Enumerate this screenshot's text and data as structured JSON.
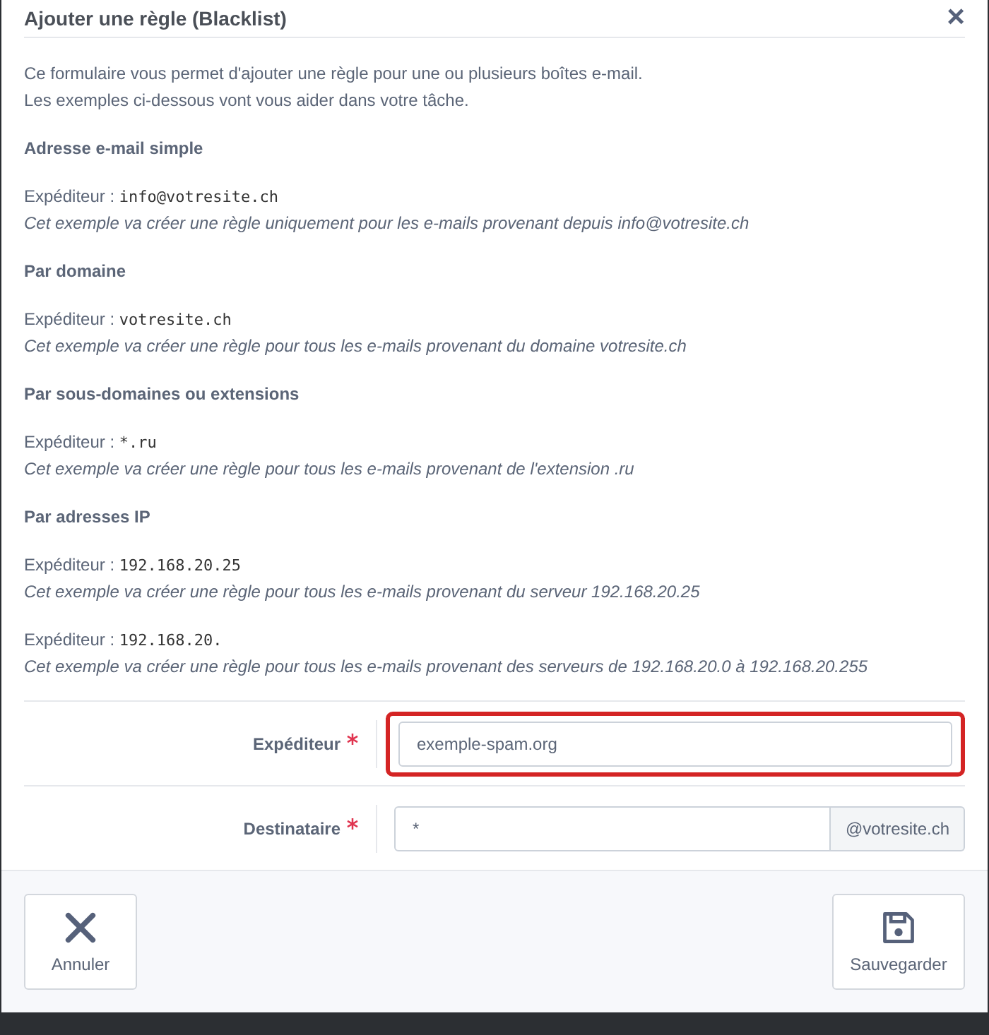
{
  "dialog": {
    "title": "Ajouter une règle (Blacklist)",
    "close": "×"
  },
  "intro": [
    "Ce formulaire vous permet d'ajouter une règle pour une ou plusieurs boîtes e-mail.",
    "Les exemples ci-dessous vont vous aider dans votre tâche."
  ],
  "sections": [
    {
      "heading": "Adresse e-mail simple",
      "examples": [
        {
          "label": "Expéditeur :",
          "code": "info@votresite.ch",
          "description": "Cet exemple va créer une règle uniquement pour les e-mails provenant depuis info@votresite.ch"
        }
      ]
    },
    {
      "heading": "Par domaine",
      "examples": [
        {
          "label": "Expéditeur :",
          "code": "votresite.ch",
          "description": "Cet exemple va créer une règle pour tous les e-mails provenant du domaine votresite.ch"
        }
      ]
    },
    {
      "heading": "Par sous-domaines ou extensions",
      "examples": [
        {
          "label": "Expéditeur :",
          "code": "*.ru",
          "description": "Cet exemple va créer une règle pour tous les e-mails provenant de l'extension .ru"
        }
      ]
    },
    {
      "heading": "Par adresses IP",
      "examples": [
        {
          "label": "Expéditeur :",
          "code": "192.168.20.25",
          "description": "Cet exemple va créer une règle pour tous les e-mails provenant du serveur 192.168.20.25"
        },
        {
          "label": "Expéditeur :",
          "code": "192.168.20.",
          "description": "Cet exemple va créer une règle pour tous les e-mails provenant des serveurs de 192.168.20.0 à 192.168.20.255"
        }
      ]
    }
  ],
  "fields": [
    {
      "label": "Expéditeur",
      "required": true,
      "value": "exemple-spam.org",
      "highlighted": true
    },
    {
      "label": "Destinataire",
      "required": true,
      "value": "*",
      "addon": "@votresite.ch",
      "highlighted": false
    }
  ],
  "buttons": [
    {
      "kind": "cancel",
      "label": "Annuler"
    },
    {
      "kind": "save",
      "label": "Sauvegarder"
    }
  ]
}
